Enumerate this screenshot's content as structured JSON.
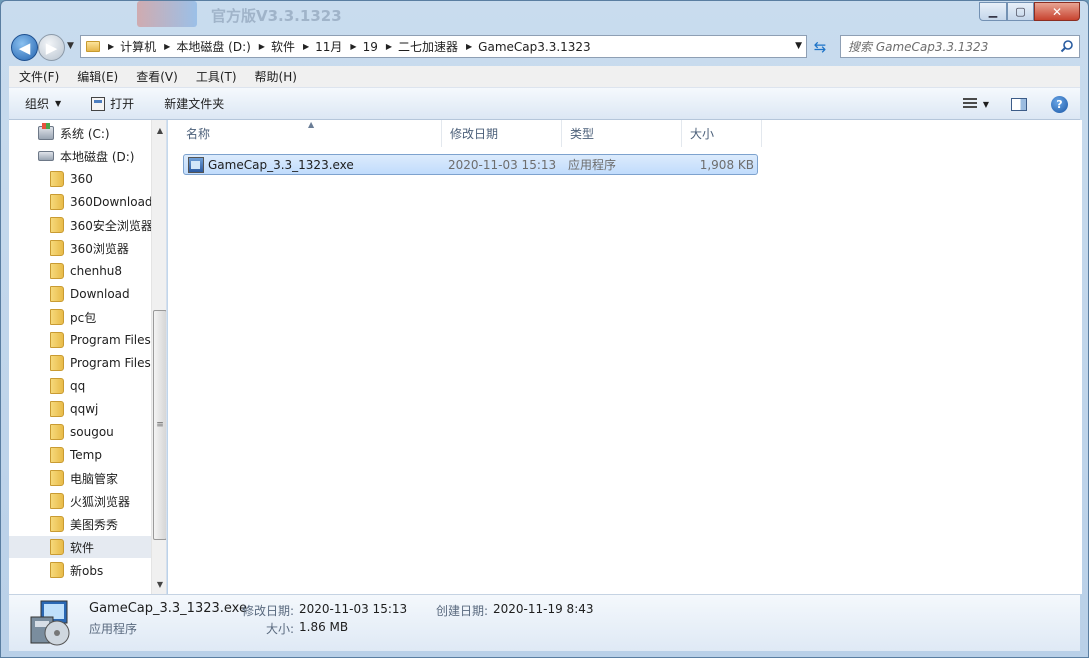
{
  "titlebar": {
    "ghost_title": "官方版V3.3.1323"
  },
  "nav": {
    "breadcrumb": [
      "计算机",
      "本地磁盘 (D:)",
      "软件",
      "11月",
      "19",
      "二七加速器",
      "GameCap3.3.1323"
    ]
  },
  "search": {
    "placeholder": "搜索 GameCap3.3.1323"
  },
  "menubar": {
    "items": [
      "文件(F)",
      "编辑(E)",
      "查看(V)",
      "工具(T)",
      "帮助(H)"
    ]
  },
  "toolbar": {
    "organize": "组织",
    "open": "打开",
    "new_folder": "新建文件夹"
  },
  "navpane": {
    "items": [
      {
        "label": "系统 (C:)",
        "icon": "system-drive-icon"
      },
      {
        "label": "本地磁盘 (D:)",
        "icon": "drive-icon"
      },
      {
        "label": "360",
        "icon": "folder-icon"
      },
      {
        "label": "360Download",
        "icon": "folder-icon"
      },
      {
        "label": "360安全浏览器",
        "icon": "folder-icon"
      },
      {
        "label": "360浏览器",
        "icon": "folder-icon"
      },
      {
        "label": "chenhu8",
        "icon": "folder-icon"
      },
      {
        "label": "Download",
        "icon": "folder-icon"
      },
      {
        "label": "pc包",
        "icon": "folder-icon"
      },
      {
        "label": "Program Files",
        "icon": "folder-icon"
      },
      {
        "label": "Program Files",
        "icon": "folder-icon"
      },
      {
        "label": "qq",
        "icon": "folder-icon"
      },
      {
        "label": "qqwj",
        "icon": "folder-icon"
      },
      {
        "label": "sougou",
        "icon": "folder-icon"
      },
      {
        "label": "Temp",
        "icon": "folder-icon"
      },
      {
        "label": "电脑管家",
        "icon": "folder-icon"
      },
      {
        "label": "火狐浏览器",
        "icon": "folder-icon"
      },
      {
        "label": "美图秀秀",
        "icon": "folder-icon"
      },
      {
        "label": "软件",
        "icon": "folder-icon"
      },
      {
        "label": "新obs",
        "icon": "folder-icon"
      }
    ],
    "selected": "软件"
  },
  "columns": {
    "name": "名称",
    "modified": "修改日期",
    "type": "类型",
    "size": "大小"
  },
  "files": [
    {
      "name": "GameCap_3.3_1323.exe",
      "modified": "2020-11-03 15:13",
      "type": "应用程序",
      "size": "1,908 KB"
    }
  ],
  "details": {
    "filename": "GameCap_3.3_1323.exe",
    "modified_label": "修改日期:",
    "modified_value": "2020-11-03 15:13",
    "created_label": "创建日期:",
    "created_value": "2020-11-19 8:43",
    "type": "应用程序",
    "size_label": "大小:",
    "size_value": "1.86 MB"
  },
  "colors": {
    "selection": "#cce4fc",
    "chrome": "#c9dcee"
  }
}
